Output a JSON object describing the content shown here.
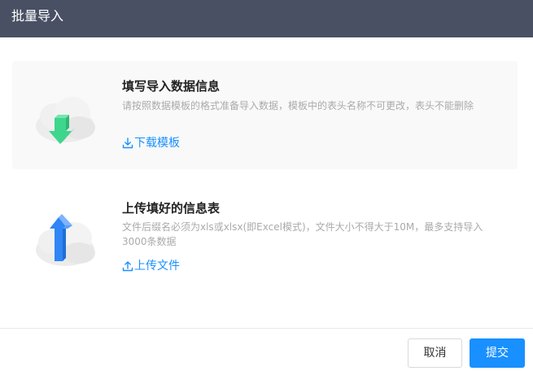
{
  "dialog": {
    "title": "批量导入"
  },
  "download_card": {
    "title": "填写导入数据信息",
    "description": "请按照数据模板的格式准备导入数据，模板中的表头名称不可更改，表头不能删除",
    "link_label": "下载模板",
    "link_icon": "download-icon",
    "illustration_icon": "cloud-download-icon"
  },
  "upload_card": {
    "title": "上传填好的信息表",
    "description": "文件后缀名必须为xls或xlsx(即Excel模式)，文件大小不得大于10M，最多支持导入3000条数据",
    "link_label": "上传文件",
    "link_icon": "upload-icon",
    "illustration_icon": "cloud-upload-icon"
  },
  "footer": {
    "cancel_label": "取消",
    "submit_label": "提交"
  },
  "colors": {
    "header_bg": "#4a5064",
    "accent": "#1890ff",
    "download_arrow": "#3dd68c",
    "upload_arrow": "#2f86f6"
  }
}
